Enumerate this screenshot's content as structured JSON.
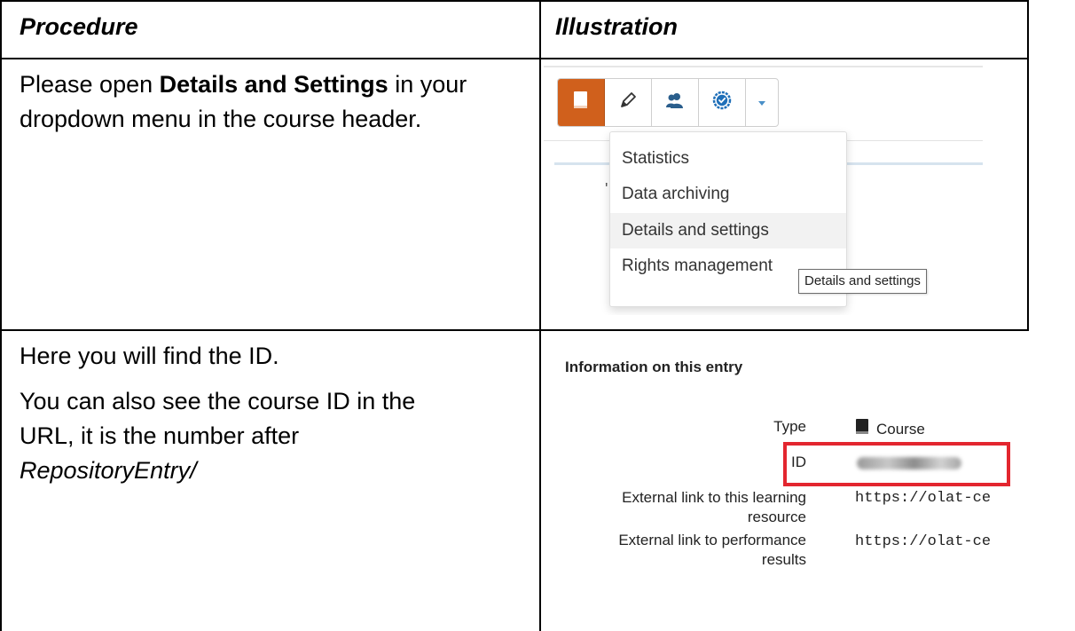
{
  "table": {
    "header_left": "Procedure",
    "header_right": "Illustration"
  },
  "row1": {
    "text_line1_pre": "Please open ",
    "text_line1_bold": "Details and Settings",
    "text_line1_post": " in your",
    "text_line2": "dropdown menu in the course header."
  },
  "dropdown": {
    "toolbar_icons": [
      "book-icon",
      "pencil-icon",
      "users-icon",
      "badge-check-icon",
      "caret-down-icon"
    ],
    "items": [
      "Statistics",
      "Data archiving",
      "Details and settings",
      "Rights management"
    ],
    "highlighted": "Details and settings",
    "tooltip": "Details and settings",
    "accent": "#d0601c",
    "stray_char": "'"
  },
  "row2": {
    "para1": "Here you will find the ID.",
    "para2_line1": "You can also see the course ID in the",
    "para2_line2": "URL, it is the number after",
    "para2_line3": "RepositoryEntry/"
  },
  "entry_info": {
    "heading": "Information on this entry",
    "type_label": "Type",
    "type_value": "Course",
    "id_label": "ID",
    "link1_label_line1": "External link to this learning",
    "link1_label_line2": "resource",
    "link1_value": "https://olat-ce",
    "link2_label_line1": "External link to performance",
    "link2_label_line2": "results",
    "link2_value": "https://olat-ce",
    "highlight_color": "#e3262f"
  }
}
